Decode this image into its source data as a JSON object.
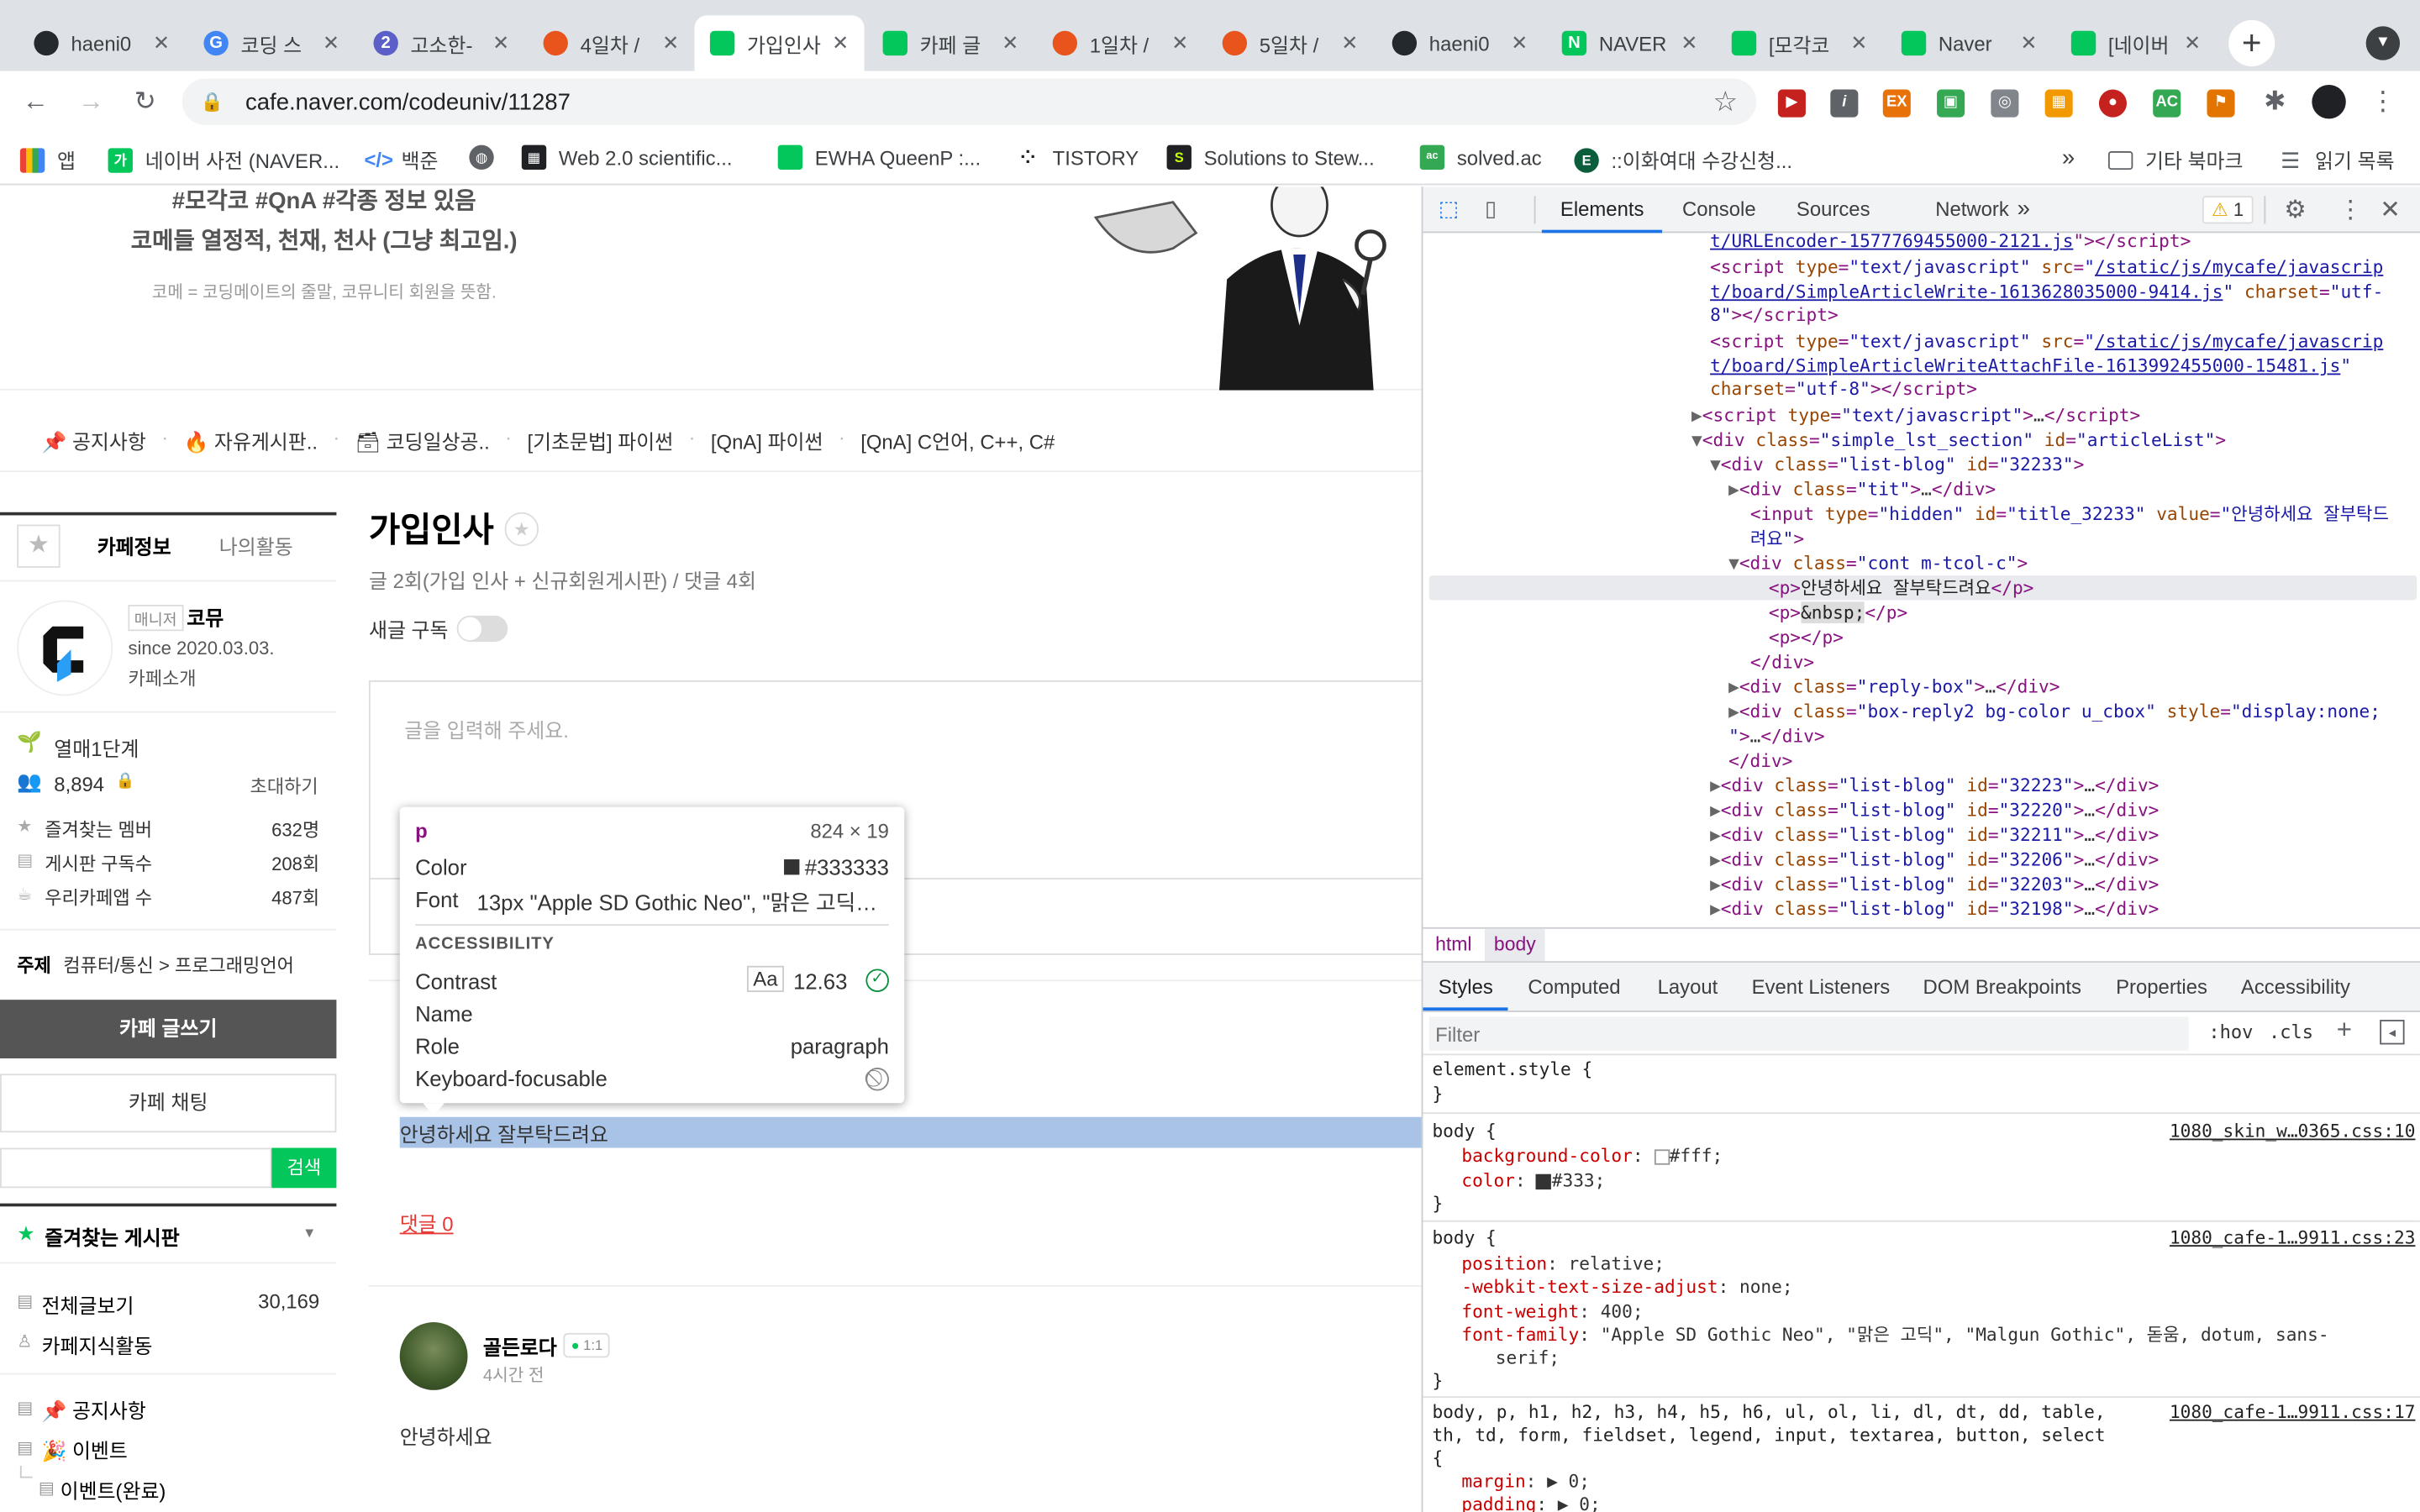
{
  "browser": {
    "tabs": [
      {
        "label": "haeni0",
        "icon": "github-icon",
        "color": "#24292e"
      },
      {
        "label": "코딩 스",
        "icon": "google-icon",
        "color": "#4285f4"
      },
      {
        "label": "고소한-",
        "icon": "codeforces-icon",
        "color": "#5b5fc7"
      },
      {
        "label": "4일차 /",
        "icon": "crab-icon",
        "color": "#e8541c"
      },
      {
        "label": "가입인사",
        "icon": "naver-cafe-icon",
        "color": "#03c75a"
      },
      {
        "label": "카페 글",
        "icon": "naver-cafe-icon",
        "color": "#03c75a"
      },
      {
        "label": "1일차 /",
        "icon": "crab-icon",
        "color": "#e8541c"
      },
      {
        "label": "5일차 /",
        "icon": "crab-icon",
        "color": "#e8541c"
      },
      {
        "label": "haeni0",
        "icon": "github-icon",
        "color": "#24292e"
      },
      {
        "label": "NAVER",
        "icon": "naver-icon",
        "color": "#03c75a"
      },
      {
        "label": "[모각코",
        "icon": "naver-cafe-icon",
        "color": "#03c75a"
      },
      {
        "label": "Naver",
        "icon": "naver-cafe-icon",
        "color": "#03c75a"
      },
      {
        "label": "[네이버",
        "icon": "naver-cafe-icon",
        "color": "#03c75a"
      }
    ],
    "url": "cafe.naver.com/codeuniv/11287",
    "bookmarks": [
      {
        "label": "앱",
        "icon": "apps-grid-icon"
      },
      {
        "label": "네이버 사전 (NAVER...",
        "icon": "naver-dict-icon"
      },
      {
        "label": "백준",
        "icon": "code-brackets-icon"
      },
      {
        "label": "",
        "icon": "globe-icon"
      },
      {
        "label": "Web 2.0 scientific...",
        "icon": "calc-icon"
      },
      {
        "label": "EWHA QueenP :...",
        "icon": "naver-cafe-icon"
      },
      {
        "label": "TISTORY",
        "icon": "tistory-icon"
      },
      {
        "label": "Solutions to Stew...",
        "icon": "s-logo-icon"
      },
      {
        "label": "solved.ac",
        "icon": "solvedac-icon"
      },
      {
        "label": "::이화여대 수강신청...",
        "icon": "ewha-icon"
      }
    ],
    "bookmarks_more": "»",
    "bookmarks_folder": "기타 북마크",
    "reading_list": "읽기 목록"
  },
  "cafe": {
    "banner": {
      "line1": "#모각코 #QnA #각종 정보 있음",
      "line2": "코메들 열정적, 천재, 천사 (그냥 최고임.)",
      "line3": "코메 = 코딩메이트의 줄말, 코뮤니티 회원을 뜻함."
    },
    "menu": [
      "📌 공지사항",
      "🔥 자유게시판..",
      "🗃 코딩일상공..",
      "[기초문법] 파이썬",
      "[QnA] 파이썬",
      "[QnA] C언어, C++, C#"
    ],
    "sidebar": {
      "tab_info": "카페정보",
      "tab_activity": "나의활동",
      "manager_badge": "매니저",
      "manager_name": "코뮤",
      "since": "since 2020.03.03.",
      "intro": "카페소개",
      "level": "열매1단계",
      "members": "8,894",
      "invite": "초대하기",
      "stats": [
        {
          "label": "즐겨찾는 멤버",
          "value": "632명"
        },
        {
          "label": "게시판 구독수",
          "value": "208회"
        },
        {
          "label": "우리카페앱 수",
          "value": "487회"
        }
      ],
      "topic_label": "주제",
      "topic_value": "컴퓨터/통신 > 프로그래밍언어",
      "write_button": "카페 글쓰기",
      "chat_button": "카페 채팅",
      "search_button": "검색",
      "fav_boards": "즐겨찾는 게시판",
      "all_posts": "전체글보기",
      "all_posts_count": "30,169",
      "knowledge": "카페지식활동",
      "boards": [
        "📌 공지사항",
        "🎉 이벤트",
        "이벤트(완료)"
      ]
    },
    "board": {
      "title": "가입인사",
      "subtitle": "글 2회(가입 인사 + 신규회원게시판) / 댓글 4회",
      "subscribe": "새글 구독",
      "editor_placeholder": "글을 입력해 주세요.",
      "post_text": "안녕하세요 잘부탁드려요",
      "comment_link": "댓글 0",
      "author": "골든로다",
      "chat_badge": "1:1",
      "time": "4시간 전",
      "post2_text": "안녕하세요"
    },
    "tooltip": {
      "tag": "p",
      "size": "824 × 19",
      "color_label": "Color",
      "color_value": "#333333",
      "font_label": "Font",
      "font_value": "13px \"Apple SD Gothic Neo\", \"맑은 고딕…",
      "accessibility": "ACCESSIBILITY",
      "contrast_label": "Contrast",
      "contrast_aa": "Aa",
      "contrast_value": "12.63",
      "name_label": "Name",
      "role_label": "Role",
      "role_value": "paragraph",
      "kb_label": "Keyboard-focusable"
    }
  },
  "devtools": {
    "tabs": [
      "Elements",
      "Console",
      "Sources",
      "Network"
    ],
    "more": "»",
    "warnings": "1",
    "breadcrumb": [
      "html",
      "body"
    ],
    "styles_tabs": [
      "Styles",
      "Computed",
      "Layout",
      "Event Listeners",
      "DOM Breakpoints",
      "Properties",
      "Accessibility"
    ],
    "filter_placeholder": "Filter",
    "hov": ":hov",
    "cls": ".cls",
    "rules": [
      {
        "selector": "element.style {",
        "src": ""
      },
      {
        "selector": "body {",
        "src": "1080_skin_w…0365.css:10"
      },
      {
        "selector": "body {",
        "src": "1080_cafe-1…9911.css:23"
      },
      {
        "selector": "body, p, h1, h2, h3, h4, h5, h6, ul, ol, li, dl, dt, dd, table,",
        "src": "1080_cafe-1…9911.css:17"
      }
    ]
  }
}
